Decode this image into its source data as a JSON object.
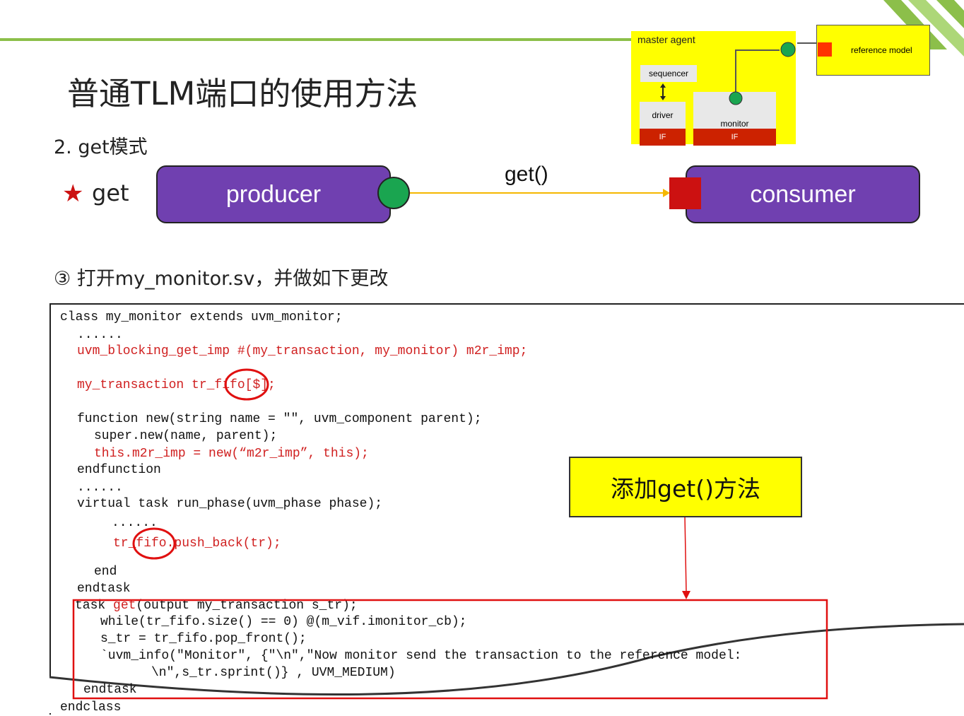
{
  "slide": {
    "title": "普通TLM端口的使用方法",
    "subtitle": "2. get模式",
    "star_label": "get",
    "producer": "producer",
    "consumer": "consumer",
    "get_call": "get()",
    "step": "③ 打开my_monitor.sv，并做如下更改",
    "callout": "添加get()方法"
  },
  "mini_diagram": {
    "master_agent": "master agent",
    "sequencer": "sequencer",
    "driver": "driver",
    "monitor": "monitor",
    "if_driver": "IF",
    "if_monitor": "IF",
    "reference_model": "reference model"
  },
  "code": {
    "l01": "class my_monitor extends uvm_monitor;",
    "l02": "......",
    "l03": "uvm_blocking_get_imp #(my_transaction, my_monitor) m2r_imp;",
    "l04": "my_transaction tr_fifo[$];",
    "l05": "function new(string name = \"\", uvm_component parent);",
    "l06": "super.new(name, parent);",
    "l07": "this.m2r_imp = new(“m2r_imp”, this);",
    "l08": "endfunction",
    "l09": "......",
    "l10": "virtual task run_phase(uvm_phase phase);",
    "l11": "......",
    "l12": "tr_fifo.push_back(tr);",
    "l13": "end",
    "l14": "endtask",
    "l15_kw": "task ",
    "l15_get": "get",
    "l15_rest": "(output my_transaction s_tr);",
    "l16": "while(tr_fifo.size() == 0) @(m_vif.imonitor_cb);",
    "l17": "s_tr = tr_fifo.pop_front();",
    "l18": "`uvm_info(\"Monitor\", {\"\\n\",\"Now monitor send the transaction to the reference model:",
    "l19": "\\n\",s_tr.sprint()} , UVM_MEDIUM)",
    "l20": "endtask",
    "l21": "endclass"
  },
  "colors": {
    "accent_green": "#8cbf4a",
    "box_purple": "#7040b0",
    "highlight_red": "#d02020",
    "callout_yellow": "#ffff00",
    "port_green": "#1aa550",
    "port_red": "#cc1111"
  }
}
